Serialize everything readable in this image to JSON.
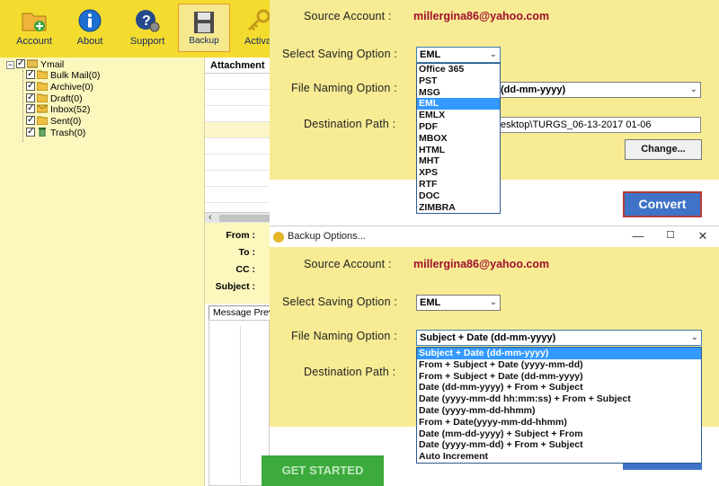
{
  "toolbar": {
    "items": [
      {
        "label": "Account",
        "icon": "folder-add-icon"
      },
      {
        "label": "About",
        "icon": "info-icon"
      },
      {
        "label": "Support",
        "icon": "help-gear-icon"
      },
      {
        "label": "Backup",
        "icon": "floppy-disk-icon"
      },
      {
        "label": "Activat",
        "icon": "key-icon"
      }
    ]
  },
  "tree": {
    "root": "Ymail",
    "folders": [
      "Bulk Mail(0)",
      "Archive(0)",
      "Draft(0)",
      "Inbox(52)",
      "Sent(0)",
      "Trash(0)"
    ]
  },
  "list": {
    "header": "Attachment"
  },
  "message": {
    "from_label": "From :",
    "to_label": "To :",
    "cc_label": "CC :",
    "subject_label": "Subject :",
    "preview_tab": "Message Preview"
  },
  "dialog1": {
    "source_account_label": "Source Account  :",
    "source_account_value": "millergina86@yahoo.com",
    "saving_option_label": "Select Saving Option  :",
    "saving_option_value": "EML",
    "saving_options": [
      "Office 365",
      "PST",
      "MSG",
      "EML",
      "EMLX",
      "PDF",
      "MBOX",
      "HTML",
      "MHT",
      "XPS",
      "RTF",
      "DOC",
      "ZIMBRA"
    ],
    "file_naming_label": "File Naming Option  :",
    "file_naming_value": "(dd-mm-yyyy)",
    "destination_label": "Destination Path  :",
    "destination_value": "esktop\\TURGS_06-13-2017 01-06",
    "change_button": "Change...",
    "convert_button": "Convert"
  },
  "dialog2": {
    "title": "Backup Options...",
    "source_account_label": "Source Account  :",
    "source_account_value": "millergina86@yahoo.com",
    "saving_option_label": "Select Saving Option  :",
    "saving_option_value": "EML",
    "file_naming_label": "File Naming Option  :",
    "file_naming_value": "Subject + Date (dd-mm-yyyy)",
    "naming_options": [
      "Subject + Date (dd-mm-yyyy)",
      "From + Subject + Date (yyyy-mm-dd)",
      "From + Subject + Date (dd-mm-yyyy)",
      "Date (dd-mm-yyyy) + From + Subject",
      "Date (yyyy-mm-dd hh:mm:ss) + From + Subject",
      "Date (yyyy-mm-dd-hhmm)",
      "From + Date(yyyy-mm-dd-hhmm)",
      "Date (mm-dd-yyyy) + Subject + From",
      "Date (yyyy-mm-dd) + From + Subject",
      "Auto Increment"
    ],
    "destination_label": "Destination Path  :"
  },
  "preview_bg": {
    "get_started": "GET STARTED"
  },
  "colors": {
    "toolbar": "#f3dc2e",
    "dialog": "#f7eb94",
    "email": "#a0102a",
    "highlight": "#3399ff",
    "convert": "#3f73c8"
  }
}
